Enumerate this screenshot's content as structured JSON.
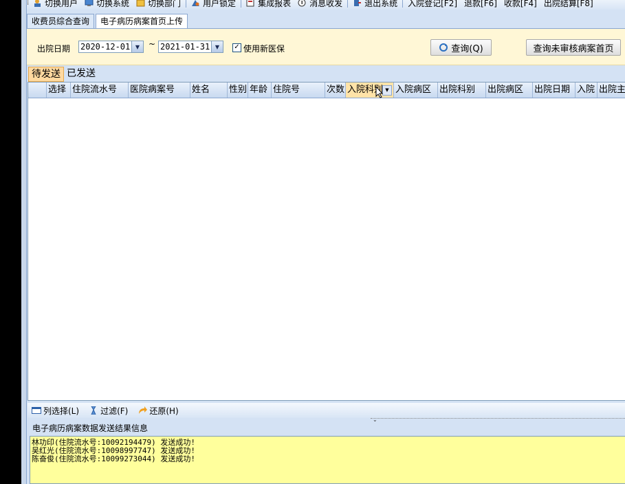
{
  "toolbar": {
    "items": [
      {
        "label": "切换用户",
        "icon": "switch-user-icon"
      },
      {
        "label": "切换系统",
        "icon": "switch-system-icon"
      },
      {
        "label": "切换部门",
        "icon": "switch-department-icon"
      },
      {
        "label": "用户锁定",
        "icon": "lock-user-icon"
      },
      {
        "label": "集成报表",
        "icon": "report-icon"
      },
      {
        "label": "消息收发",
        "icon": "message-icon"
      },
      {
        "label": "退出系统",
        "icon": "exit-icon"
      },
      {
        "label": "入院登记[F2]"
      },
      {
        "label": "退款[F6]"
      },
      {
        "label": "收款[F4]"
      },
      {
        "label": "出院结算[F8]"
      }
    ]
  },
  "tabs": [
    "收费员综合查询",
    "电子病历病案首页上传"
  ],
  "filter": {
    "date_label": "出院日期",
    "date_from": "2020-12-01",
    "tilde": "~",
    "date_to": "2021-01-31",
    "checkbox_label": "使用新医保",
    "checkbox_checked": true,
    "query_button": "查询(Q)",
    "unreviewed_button": "查询未审核病案首页"
  },
  "subtabs": [
    "待发送",
    "已发送"
  ],
  "grid": {
    "columns": [
      "",
      "选择",
      "住院流水号",
      "医院病案号",
      "姓名",
      "性别",
      "年龄",
      "住院号",
      "次数",
      "入院科别",
      "入院病区",
      "出院科别",
      "出院病区",
      "出院日期",
      "入院",
      "出院主"
    ],
    "rows": []
  },
  "bottom_bar": {
    "items": [
      {
        "label": "列选择(L)",
        "icon": "column-select-icon"
      },
      {
        "label": "过滤(F)",
        "icon": "filter-icon"
      },
      {
        "label": "还原(H)",
        "icon": "restore-icon"
      }
    ]
  },
  "result": {
    "title": "电子病历病案数据发送结果信息",
    "lines": [
      "林功印(住院流水号:10092194479) 发送成功!",
      "吴红光(住院流水号:10098997747) 发送成功!",
      "陈奋俊(住院流水号:10099273044) 发送成功!"
    ]
  },
  "colors": {
    "filter_bg": "#fff7d6",
    "result_bg": "#ffff9c",
    "active_subtab": "#ffd9a0"
  }
}
